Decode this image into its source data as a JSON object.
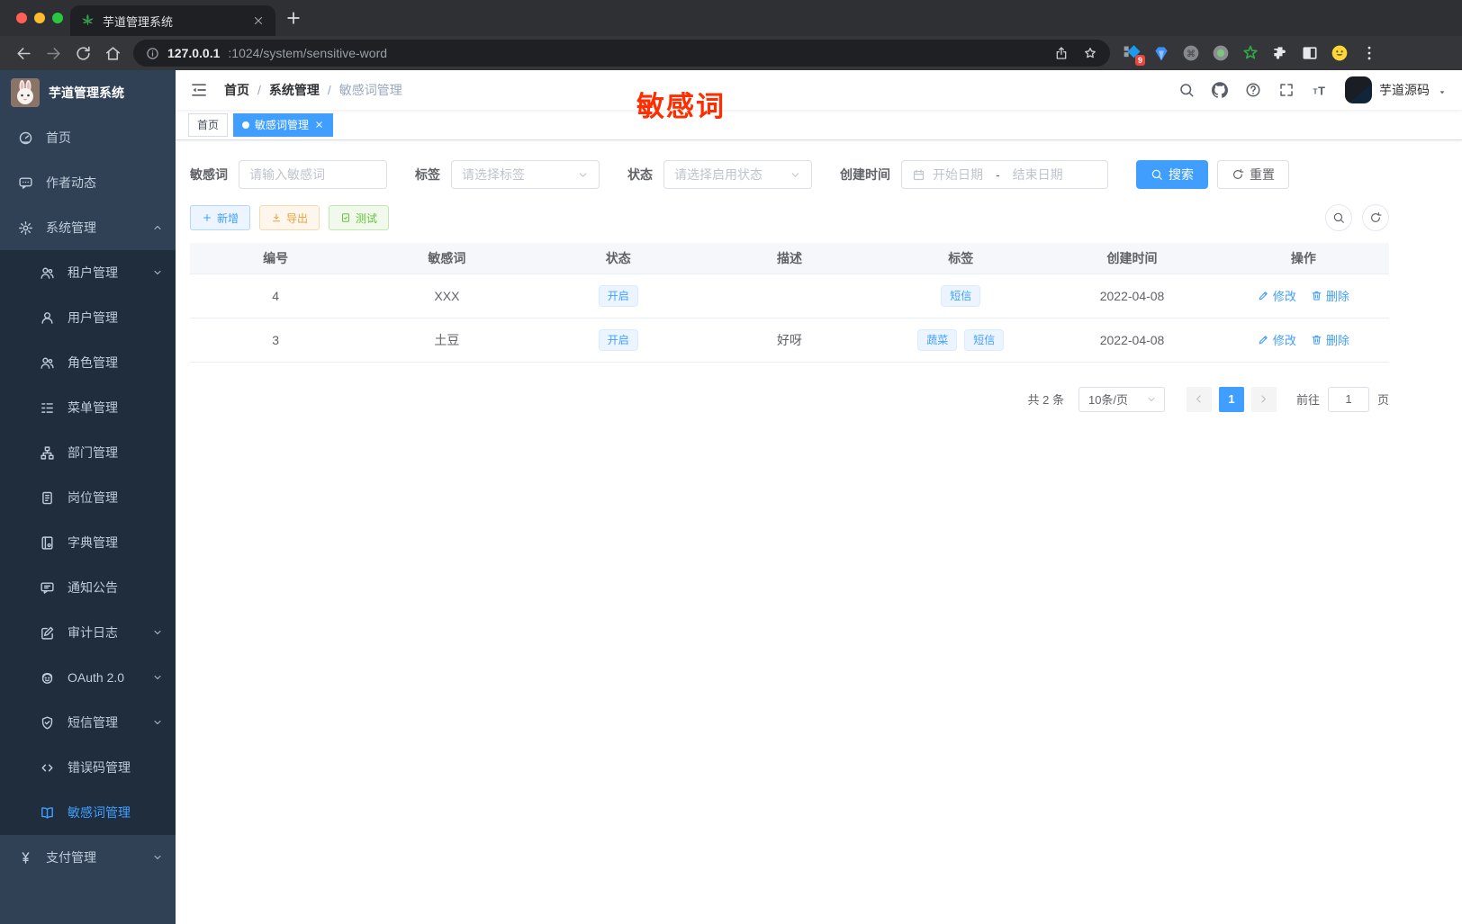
{
  "browser": {
    "tab_title": "芋道管理系统",
    "url_host": "127.0.0.1",
    "url_path": ":1024/system/sensitive-word",
    "extension_badge": "9",
    "nav_icons": [
      "back-icon",
      "forward-icon",
      "reload-icon",
      "home-icon"
    ],
    "url_icons_right": [
      "share-icon",
      "star-icon"
    ],
    "extensions": [
      "extensions-grid-icon",
      "gem-icon",
      "command-icon",
      "record-icon",
      "green-star-icon",
      "puzzle-icon",
      "side-panel-icon",
      "profile-avatar-icon",
      "kebab-menu-icon"
    ]
  },
  "sidebar": {
    "logo_title": "芋道管理系统",
    "items": [
      {
        "label": "首页",
        "icon": "dashboard-icon",
        "level": 1
      },
      {
        "label": "作者动态",
        "icon": "chat-icon",
        "level": 1
      },
      {
        "label": "系统管理",
        "icon": "gear-icon",
        "level": 1,
        "chevron": "up"
      },
      {
        "label": "租户管理",
        "icon": "users-icon",
        "level": 2,
        "chevron": "down"
      },
      {
        "label": "用户管理",
        "icon": "user-icon",
        "level": 2
      },
      {
        "label": "角色管理",
        "icon": "role-icon",
        "level": 2
      },
      {
        "label": "菜单管理",
        "icon": "menu-tree-icon",
        "level": 2
      },
      {
        "label": "部门管理",
        "icon": "dept-icon",
        "level": 2
      },
      {
        "label": "岗位管理",
        "icon": "post-icon",
        "level": 2
      },
      {
        "label": "字典管理",
        "icon": "dict-icon",
        "level": 2
      },
      {
        "label": "通知公告",
        "icon": "notice-icon",
        "level": 2
      },
      {
        "label": "审计日志",
        "icon": "audit-icon",
        "level": 2,
        "chevron": "down"
      },
      {
        "label": "OAuth 2.0",
        "icon": "oauth-icon",
        "level": 2,
        "chevron": "down"
      },
      {
        "label": "短信管理",
        "icon": "sms-shield-icon",
        "level": 2,
        "chevron": "down"
      },
      {
        "label": "错误码管理",
        "icon": "code-icon",
        "level": 2
      },
      {
        "label": "敏感词管理",
        "icon": "open-book-icon",
        "level": 2,
        "active": true
      },
      {
        "label": "支付管理",
        "icon": "pay-yen-icon",
        "level": 1,
        "chevron": "down"
      }
    ]
  },
  "header": {
    "breadcrumb": [
      "首页",
      "系统管理",
      "敏感词管理"
    ],
    "separator": "/",
    "right_icons": [
      "search-icon",
      "github-icon",
      "question-icon",
      "fullscreen-icon",
      "font-size-icon"
    ],
    "username": "芋道源码"
  },
  "annotation": {
    "text": "敏感词",
    "color": "#ff2d00"
  },
  "tags_view": [
    {
      "label": "首页",
      "active": false,
      "closable": false
    },
    {
      "label": "敏感词管理",
      "active": true,
      "closable": true
    }
  ],
  "filters": {
    "keyword": {
      "label": "敏感词",
      "placeholder": "请输入敏感词"
    },
    "tag": {
      "label": "标签",
      "placeholder": "请选择标签"
    },
    "status": {
      "label": "状态",
      "placeholder": "请选择启用状态"
    },
    "created": {
      "label": "创建时间",
      "start_placeholder": "开始日期",
      "separator": "-",
      "end_placeholder": "结束日期"
    },
    "search_label": "搜索",
    "reset_label": "重置"
  },
  "toolbar": {
    "add_label": "新增",
    "export_label": "导出",
    "test_label": "测试"
  },
  "table": {
    "headers": [
      "编号",
      "敏感词",
      "状态",
      "描述",
      "标签",
      "创建时间",
      "操作"
    ],
    "rows": [
      {
        "id": "4",
        "word": "XXX",
        "status": "开启",
        "description": "",
        "tags": [
          "短信"
        ],
        "created": "2022-04-08"
      },
      {
        "id": "3",
        "word": "土豆",
        "status": "开启",
        "description": "好呀",
        "tags": [
          "蔬菜",
          "短信"
        ],
        "created": "2022-04-08"
      }
    ],
    "edit_label": "修改",
    "delete_label": "删除"
  },
  "pagination": {
    "total": "共 2 条",
    "page_size": "10条/页",
    "current_page": "1",
    "goto_label": "前往",
    "page_unit": "页"
  },
  "colors": {
    "primary": "#409eff",
    "warning": "#e6a23c",
    "success": "#67c23a",
    "annotation_red": "#ff2d00",
    "sidebar_bg": "#304156",
    "submenu_bg": "#1f2d3d"
  }
}
